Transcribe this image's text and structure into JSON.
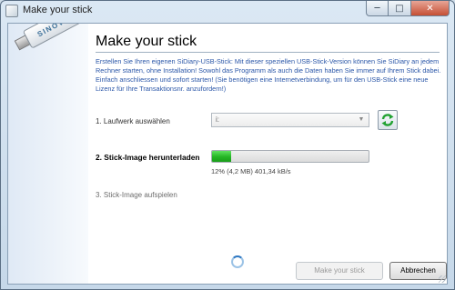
{
  "window": {
    "title": "Make your stick",
    "minimize_glyph": "─",
    "maximize_glyph": "□",
    "close_glyph": "✕"
  },
  "branding": {
    "stick_label": "SINOVO",
    "icon": "usb-stick-icon"
  },
  "page": {
    "heading": "Make your stick",
    "intro": "Erstellen Sie Ihren eigenen SiDiary-USB-Stick: Mit dieser speziellen USB-Stick-Version können Sie SiDiary an jedem Rechner starten, ohne Installation! Sowohl das Programm als auch die Daten haben Sie immer auf Ihrem Stick dabei. Einfach anschliessen und sofort starten! (Sie benötigen eine Internetverbindung, um für den USB-Stick eine neue Lizenz für Ihre Transaktionsnr. anzufordern!)"
  },
  "steps": {
    "step1_label": "1. Laufwerk auswählen",
    "drive_value": "i:",
    "drive_dropdown_icon": "chevron-down-icon",
    "refresh_icon": "refresh-icon",
    "step2_label": "2. Stick-Image herunterladen",
    "progress_fraction": 0.12,
    "progress_status": "12% (4,2 MB) 401,34  kB/s",
    "step3_label": "3. Stick-Image aufspielen"
  },
  "buttons": {
    "make_label": "Make your stick",
    "cancel_label": "Abbrechen"
  },
  "colors": {
    "intro_text": "#2b57a8",
    "progress_green": "#25b525",
    "close_button": "#c54f34"
  }
}
